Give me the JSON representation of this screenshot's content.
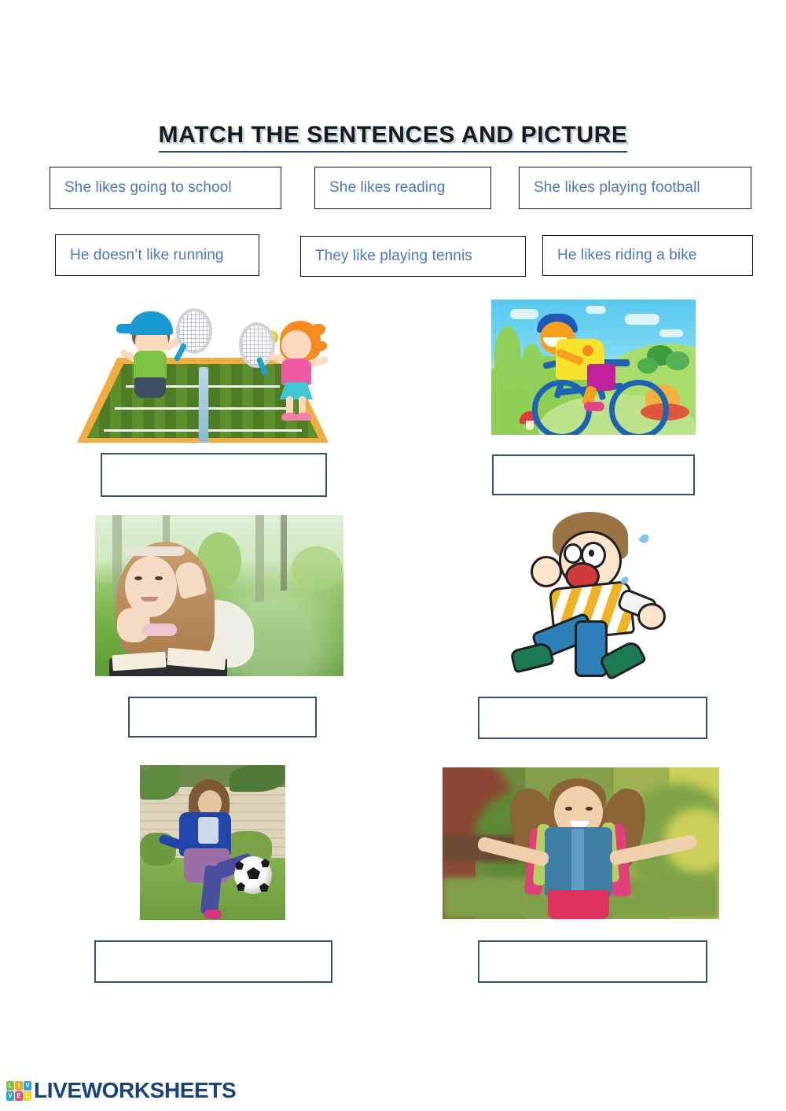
{
  "title": {
    "text": "MATCH THE SENTENCES AND PICTURE"
  },
  "sentences": [
    {
      "id": "sentence-going-to-school",
      "text": "She likes going to school"
    },
    {
      "id": "sentence-reading",
      "text": "She likes reading"
    },
    {
      "id": "sentence-playing-football",
      "text": "She likes playing football"
    },
    {
      "id": "sentence-running",
      "text": "He doesn’t like running"
    },
    {
      "id": "sentence-playing-tennis",
      "text": "They like playing tennis"
    },
    {
      "id": "sentence-riding-a-bike",
      "text": "He likes riding a bike"
    }
  ],
  "items": [
    {
      "id": "item-tennis",
      "picture": "two-children-playing-tennis-illustration",
      "answer": ""
    },
    {
      "id": "item-bike",
      "picture": "boy-riding-bicycle-illustration",
      "answer": ""
    },
    {
      "id": "item-reading",
      "picture": "girl-reading-book-on-grass-photo",
      "answer": ""
    },
    {
      "id": "item-running",
      "picture": "boy-running-cartoon",
      "answer": ""
    },
    {
      "id": "item-football",
      "picture": "girl-kicking-soccer-ball-photo",
      "answer": ""
    },
    {
      "id": "item-school",
      "picture": "girl-with-backpack-going-to-school-photo",
      "answer": ""
    }
  ],
  "footer": {
    "brand": "LIVEWORKSHEETS",
    "tiles": [
      {
        "letter": "L",
        "color": "#7cc242"
      },
      {
        "letter": "I",
        "color": "#f5a623"
      },
      {
        "letter": "V",
        "color": "#29a3dc"
      },
      {
        "letter": "V",
        "color": "#29a3dc"
      },
      {
        "letter": "E",
        "color": "#e4467a"
      },
      {
        "letter": "L",
        "color": "#f5d423"
      }
    ]
  },
  "colors": {
    "sentence_text": "#4a76c4",
    "sentence_border": "#111111",
    "answer_border": "#32536f",
    "title_text": "#1a1a1a",
    "title_shadow": "#b9d3e8",
    "brand": "#18437f"
  }
}
